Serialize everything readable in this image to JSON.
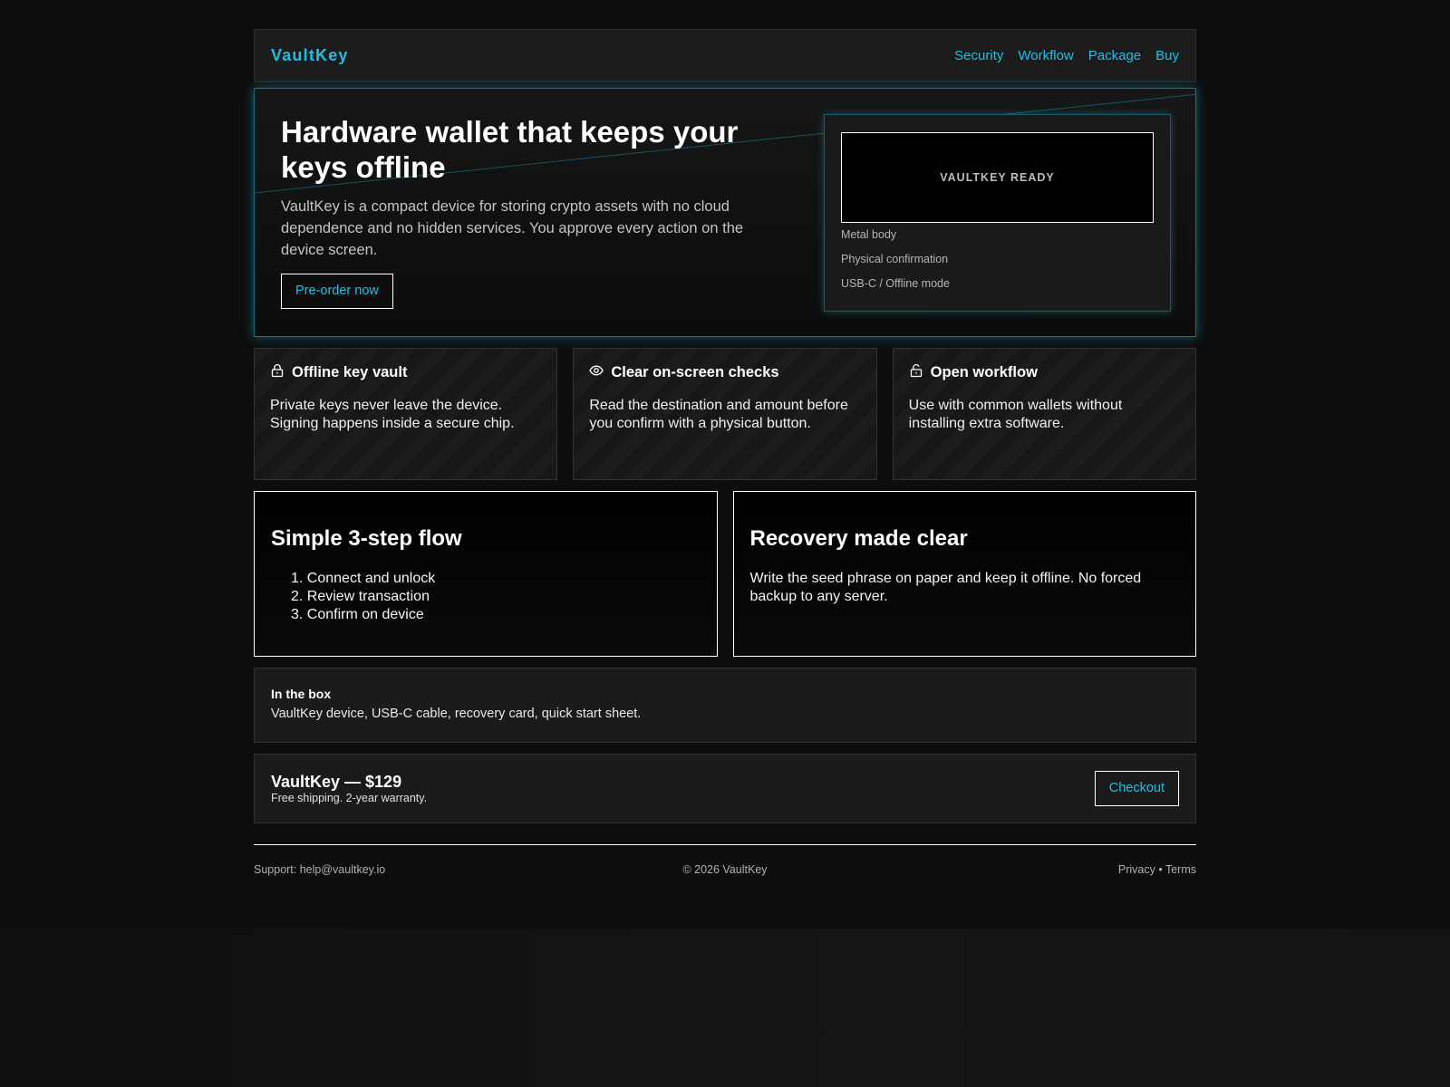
{
  "header": {
    "brand": "VaultKey",
    "nav": [
      "Security",
      "Workflow",
      "Package",
      "Buy"
    ]
  },
  "hero": {
    "title": "Hardware wallet that keeps your keys offline",
    "text": "VaultKey is a compact device for storing crypto assets with no cloud dependence and no hidden services. You approve every action on the device screen.",
    "cta_label": "Pre-order now",
    "device_screen": "VAULTKEY READY",
    "specs": [
      "Metal body",
      "Physical confirmation",
      "USB-C / Offline mode"
    ]
  },
  "features": [
    {
      "icon": "lock-icon",
      "title": "Offline key vault",
      "text": "Private keys never leave the device. Signing happens inside a secure chip."
    },
    {
      "icon": "eye-icon",
      "title": "Clear on-screen checks",
      "text": "Read the destination and amount before you confirm with a physical button."
    },
    {
      "icon": "unlock-icon",
      "title": "Open workflow",
      "text": "Use with common wallets without installing extra software."
    }
  ],
  "workflow": {
    "title": "Simple 3-step flow",
    "steps": [
      "1. Connect and unlock",
      "2. Review transaction",
      "3. Confirm on device"
    ]
  },
  "recovery": {
    "title": "Recovery made clear",
    "text": "Write the seed phrase on paper and keep it offline. No forced backup to any server."
  },
  "package": {
    "title": "In the box",
    "text": "VaultKey device, USB-C cable, recovery card, quick start sheet."
  },
  "buy": {
    "price": "VaultKey — $129",
    "subtext": "Free shipping. 2-year warranty.",
    "checkout_label": "Checkout"
  },
  "footer": {
    "support": "Support: help@vaultkey.io",
    "copyright": "© 2026 VaultKey",
    "links": "Privacy • Terms"
  },
  "colors": {
    "accent": "#1fc0e6",
    "background": "#0d0d0d",
    "card": "#1b1b1b"
  }
}
